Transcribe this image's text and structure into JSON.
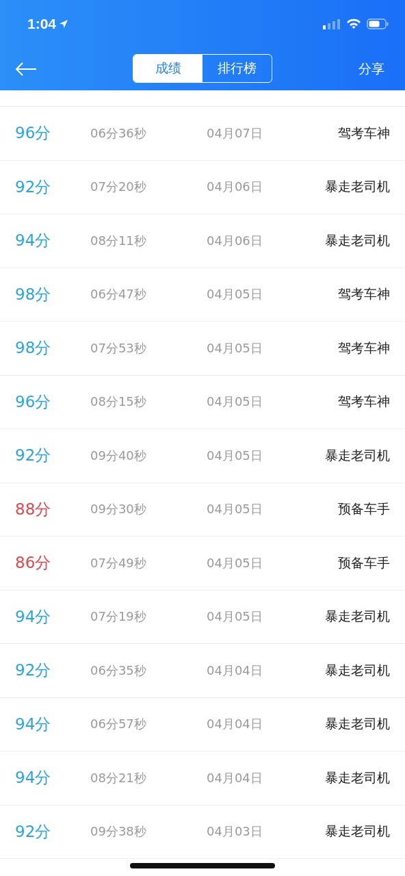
{
  "status_bar": {
    "time": "1:04"
  },
  "nav": {
    "tabs": [
      {
        "label": "成绩",
        "selected": true
      },
      {
        "label": "排行榜",
        "selected": false
      }
    ],
    "share": "分享"
  },
  "rows": [
    {
      "score": "96分",
      "color": "#2ba3dc",
      "duration": "06分36秒",
      "date": "04月07日",
      "title": "驾考车神"
    },
    {
      "score": "92分",
      "color": "#2ba3dc",
      "duration": "07分20秒",
      "date": "04月06日",
      "title": "暴走老司机"
    },
    {
      "score": "94分",
      "color": "#2ba3dc",
      "duration": "08分11秒",
      "date": "04月06日",
      "title": "暴走老司机"
    },
    {
      "score": "98分",
      "color": "#2ba3dc",
      "duration": "06分47秒",
      "date": "04月05日",
      "title": "驾考车神"
    },
    {
      "score": "98分",
      "color": "#2ba3dc",
      "duration": "07分53秒",
      "date": "04月05日",
      "title": "驾考车神"
    },
    {
      "score": "96分",
      "color": "#2ba3dc",
      "duration": "08分15秒",
      "date": "04月05日",
      "title": "驾考车神"
    },
    {
      "score": "92分",
      "color": "#2ba3dc",
      "duration": "09分40秒",
      "date": "04月05日",
      "title": "暴走老司机"
    },
    {
      "score": "88分",
      "color": "#e0474c",
      "duration": "09分30秒",
      "date": "04月05日",
      "title": "预备车手"
    },
    {
      "score": "86分",
      "color": "#e0474c",
      "duration": "07分49秒",
      "date": "04月05日",
      "title": "预备车手"
    },
    {
      "score": "94分",
      "color": "#2ba3dc",
      "duration": "07分19秒",
      "date": "04月05日",
      "title": "暴走老司机"
    },
    {
      "score": "92分",
      "color": "#2ba3dc",
      "duration": "06分35秒",
      "date": "04月04日",
      "title": "暴走老司机"
    },
    {
      "score": "94分",
      "color": "#2ba3dc",
      "duration": "06分57秒",
      "date": "04月04日",
      "title": "暴走老司机"
    },
    {
      "score": "94分",
      "color": "#2ba3dc",
      "duration": "08分21秒",
      "date": "04月04日",
      "title": "暴走老司机"
    },
    {
      "score": "92分",
      "color": "#2ba3dc",
      "duration": "09分38秒",
      "date": "04月03日",
      "title": "暴走老司机"
    }
  ]
}
